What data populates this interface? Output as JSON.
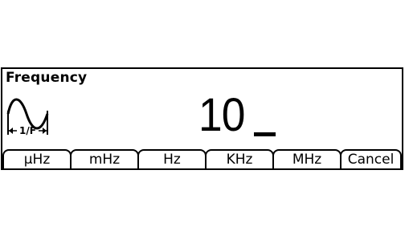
{
  "screen": {
    "title": "Frequency",
    "icon": "sine-wave-period-icon",
    "icon_label": "1/F",
    "value": "10",
    "cursor": "_"
  },
  "softkeys": [
    {
      "label": "µHz"
    },
    {
      "label": "mHz"
    },
    {
      "label": "Hz"
    },
    {
      "label": "KHz"
    },
    {
      "label": "MHz"
    },
    {
      "label": "Cancel"
    }
  ]
}
